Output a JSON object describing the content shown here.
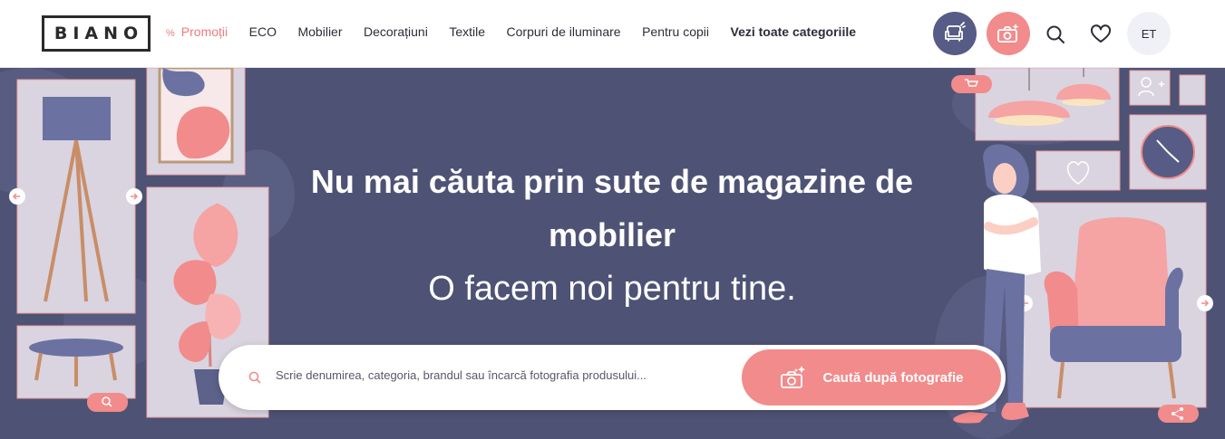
{
  "logo": {
    "text": "BIANO"
  },
  "nav": {
    "promo_symbol": "%",
    "items": [
      {
        "label": "Promoții"
      },
      {
        "label": "ECO"
      },
      {
        "label": "Mobilier"
      },
      {
        "label": "Decorațiuni"
      },
      {
        "label": "Textile"
      },
      {
        "label": "Corpuri de iluminare"
      },
      {
        "label": "Pentru copii"
      },
      {
        "label": "Vezi toate categoriile"
      }
    ]
  },
  "header": {
    "lang_label": "ET"
  },
  "hero": {
    "headline": "Nu mai căuta prin sute de magazine de mobilier",
    "subheadline": "O facem noi pentru tine."
  },
  "search": {
    "placeholder": "Scrie denumirea, categoria, brandul sau încarcă fotografia produsului...",
    "value": "",
    "photo_button_label": "Caută după fotografie"
  },
  "colors": {
    "accent": "#f28b8b",
    "hero_bg": "#4e5275",
    "brand_dark": "#565c86"
  },
  "icons": [
    "sofa-icon",
    "camera-icon",
    "search-icon",
    "heart-icon",
    "cart-icon",
    "add-user-icon",
    "share-icon",
    "arrow-left-icon",
    "arrow-right-icon"
  ]
}
